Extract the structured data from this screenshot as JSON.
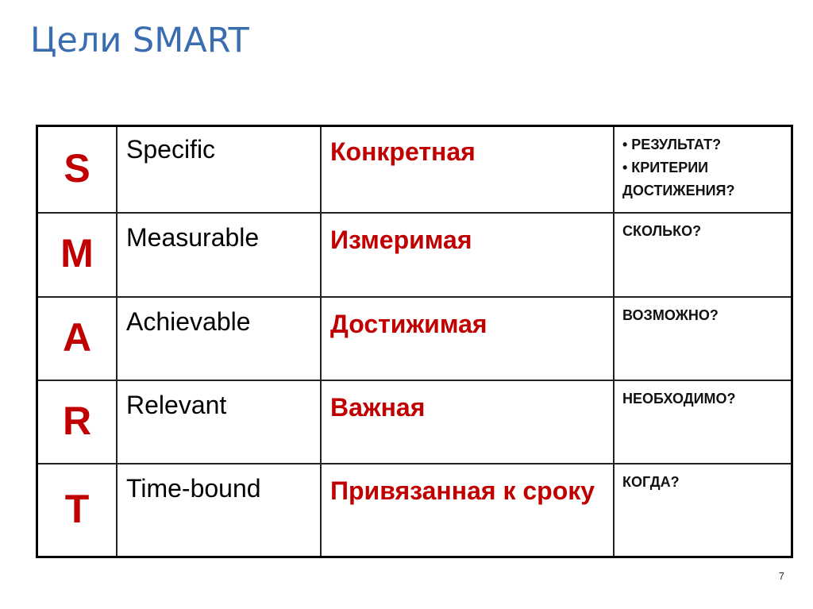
{
  "title": "Цели SMART",
  "colors": {
    "title": "#3a6db0",
    "accent": "#c00000",
    "text": "#000000"
  },
  "rows": [
    {
      "letter": "S",
      "english": "Specific",
      "russian": "Конкретная",
      "questions": [
        "• РЕЗУЛЬТАТ?",
        "• КРИТЕРИИ ДОСТИЖЕНИЯ?"
      ]
    },
    {
      "letter": "M",
      "english": "Measurable",
      "russian": "Измеримая",
      "questions": [
        "СКОЛЬКО?"
      ]
    },
    {
      "letter": "A",
      "english": "Achievable",
      "russian": "Достижимая",
      "questions": [
        "ВОЗМОЖНО?"
      ]
    },
    {
      "letter": "R",
      "english": "Relevant",
      "russian": "Важная",
      "questions": [
        "НЕОБХОДИМО?"
      ]
    },
    {
      "letter": "T",
      "english": "Time-bound",
      "russian": "Привязанная к сроку",
      "questions": [
        "КОГДА?"
      ]
    }
  ],
  "page_number": "7"
}
